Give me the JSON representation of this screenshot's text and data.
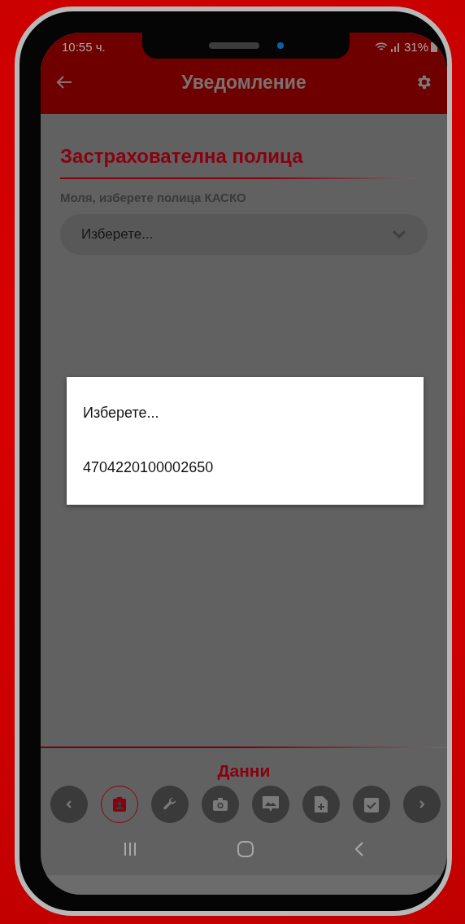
{
  "status_bar": {
    "time": "10:55 ч.",
    "battery": "31%"
  },
  "app_bar": {
    "title": "Уведомление"
  },
  "section": {
    "title": "Застрахователна полица",
    "field_label": "Моля, изберете полица КАСКО",
    "select": {
      "value": "Изберете..."
    }
  },
  "dialog": {
    "options": [
      {
        "label": "Изберете..."
      },
      {
        "label": "4704220100002650"
      }
    ]
  },
  "step_nav": {
    "title": "Данни",
    "steps": [
      {
        "kind": "prev",
        "selected": false
      },
      {
        "kind": "data",
        "selected": true
      },
      {
        "kind": "repair",
        "selected": false
      },
      {
        "kind": "camera",
        "selected": false
      },
      {
        "kind": "photo",
        "selected": false
      },
      {
        "kind": "document",
        "selected": false
      },
      {
        "kind": "check",
        "selected": false
      },
      {
        "kind": "next",
        "selected": false
      }
    ]
  }
}
